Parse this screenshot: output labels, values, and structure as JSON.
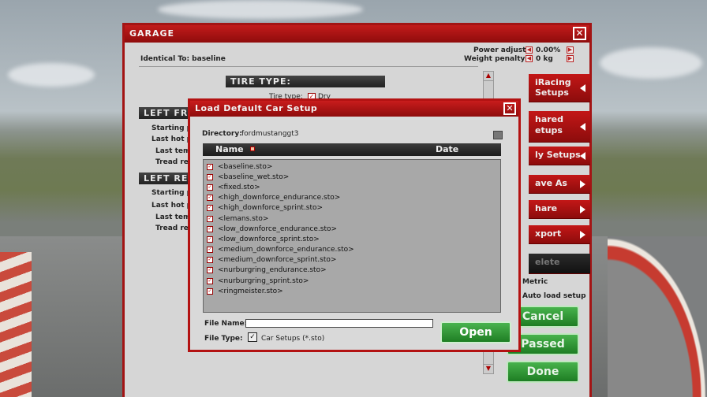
{
  "garage": {
    "title": "GARAGE",
    "identical_to": "Identical To: baseline",
    "power_adjust_label": "Power adjust:",
    "power_adjust_value": "0.00%",
    "weight_penalty_label": "Weight penalty:",
    "weight_penalty_value": "0 kg",
    "tire_type_header": "TIRE TYPE:",
    "tire_type_label": "Tire type:",
    "tire_type_value": "Dry",
    "left_front_header": "LEFT FR",
    "left_rear_header": "LEFT RE",
    "lf_rows": [
      "Starting pre",
      "Last hot pre",
      "Last temps",
      "Tread rem"
    ],
    "lr_rows": [
      "Starting pre",
      "Last hot pre",
      "Last temps",
      "Tread rem"
    ]
  },
  "side": {
    "iracing_setups": "iRacing Setups",
    "shared_setups": "hared etups",
    "my_setups": "ly Setups",
    "save_as": "ave As",
    "share": "hare",
    "export": "xport",
    "delete": "elete",
    "metric": "Metric",
    "auto_load": "Auto load setup",
    "cancel": "Cancel",
    "passed": "Passed",
    "done": "Done"
  },
  "dialog": {
    "title": "Load Default Car Setup",
    "directory_label": "Directory:",
    "directory_value": "fordmustanggt3",
    "col_name": "Name",
    "col_date": "Date",
    "files": [
      "<baseline.sto>",
      "<baseline_wet.sto>",
      "<fixed.sto>",
      "<high_downforce_endurance.sto>",
      "<high_downforce_sprint.sto>",
      "<lemans.sto>",
      "<low_downforce_endurance.sto>",
      "<low_downforce_sprint.sto>",
      "<medium_downforce_endurance.sto>",
      "<medium_downforce_sprint.sto>",
      "<nurburgring_endurance.sto>",
      "<nurburgring_sprint.sto>",
      "<ringmeister.sto>"
    ],
    "file_name_label": "File Name:",
    "file_name_value": "",
    "file_type_label": "File Type:",
    "file_type_value": "Car Setups (*.sto)",
    "open": "Open"
  },
  "colors": {
    "accent_red": "#b31212",
    "green": "#2e9a33"
  }
}
